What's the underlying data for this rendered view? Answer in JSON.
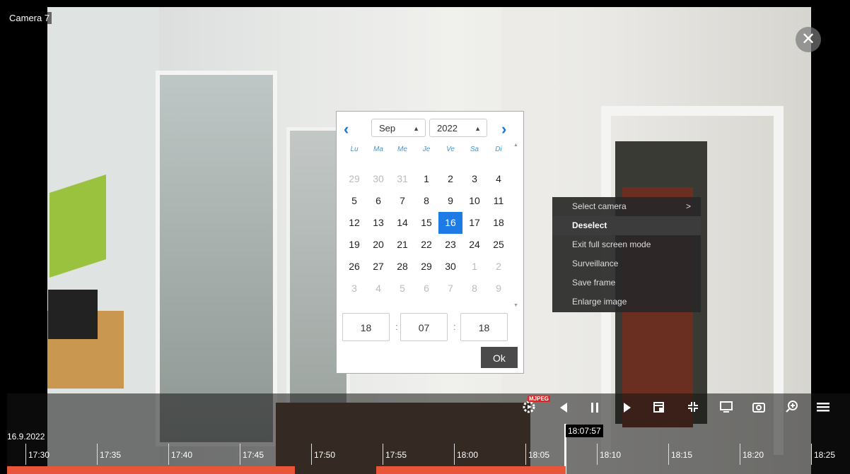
{
  "camera": {
    "title": "Camera 7"
  },
  "calendar": {
    "month": "Sep",
    "year": "2022",
    "weekdays": [
      "Lu",
      "Ma",
      "Me",
      "Je",
      "Ve",
      "Sa",
      "Di"
    ],
    "weeks": [
      [
        "29",
        "30",
        "31",
        "1",
        "2",
        "3",
        "4"
      ],
      [
        "5",
        "6",
        "7",
        "8",
        "9",
        "10",
        "11"
      ],
      [
        "12",
        "13",
        "14",
        "15",
        "16",
        "17",
        "18"
      ],
      [
        "19",
        "20",
        "21",
        "22",
        "23",
        "24",
        "25"
      ],
      [
        "26",
        "27",
        "28",
        "29",
        "30",
        "1",
        "2"
      ],
      [
        "3",
        "4",
        "5",
        "6",
        "7",
        "8",
        "9"
      ]
    ],
    "selected_day": "16",
    "time": {
      "hours": "18",
      "minutes": "07",
      "seconds": "18",
      "sep": ":"
    },
    "ok_label": "Ok"
  },
  "context_menu": {
    "items": [
      {
        "label": "Select camera",
        "submenu": ">"
      },
      {
        "label": "Deselect"
      },
      {
        "label": "Exit full screen mode"
      },
      {
        "label": "Surveillance"
      },
      {
        "label": "Save frame"
      },
      {
        "label": "Enlarge image"
      }
    ]
  },
  "controls": {
    "codec_badge": "MJPEG",
    "close": "✕"
  },
  "timeline": {
    "date": "16.9.2022",
    "cursor_time": "18:07:57",
    "ticks": [
      "17:30",
      "17:35",
      "17:40",
      "17:45",
      "17:50",
      "17:55",
      "18:00",
      "18:05",
      "18:10",
      "18:15",
      "18:20",
      "18:25"
    ]
  },
  "colors": {
    "accent": "#1e7be6",
    "recording": "#e8563a",
    "badge": "#d92727"
  }
}
